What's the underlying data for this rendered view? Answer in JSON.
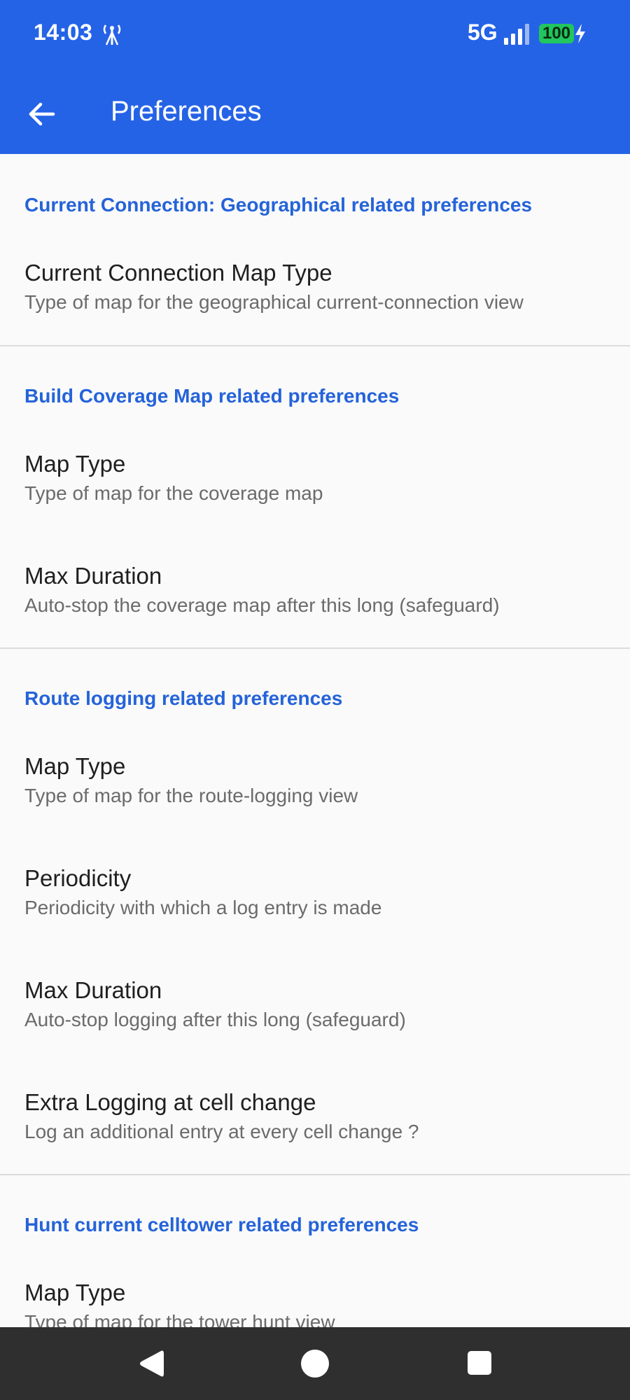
{
  "status_bar": {
    "time": "14:03",
    "network": "5G",
    "battery": "100",
    "icons": [
      "antenna-icon",
      "signal-icon",
      "battery-icon",
      "charging-bolt-icon"
    ]
  },
  "app_bar": {
    "title": "Preferences",
    "back_icon": "arrow-left-icon",
    "color": "#2563e6"
  },
  "sections": [
    {
      "header": "Current Connection: Geographical related preferences",
      "items": [
        {
          "title": "Current Connection Map Type",
          "summary": "Type of map for the geographical current-connection view"
        }
      ]
    },
    {
      "header": "Build Coverage Map related preferences",
      "items": [
        {
          "title": "Map Type",
          "summary": "Type of map for the coverage map"
        },
        {
          "title": "Max Duration",
          "summary": "Auto-stop the coverage map after this long (safeguard)"
        }
      ]
    },
    {
      "header": "Route logging related preferences",
      "items": [
        {
          "title": "Map Type",
          "summary": "Type of map for the route-logging view"
        },
        {
          "title": "Periodicity",
          "summary": "Periodicity with which a log entry is made"
        },
        {
          "title": "Max Duration",
          "summary": "Auto-stop logging after this long (safeguard)"
        },
        {
          "title": "Extra Logging at cell change",
          "summary": "Log an additional entry at every cell change ?"
        }
      ]
    },
    {
      "header": "Hunt current celltower related preferences",
      "items": [
        {
          "title": "Map Type",
          "summary": "Type of map for the tower hunt view"
        }
      ]
    }
  ],
  "nav_bar": {
    "icons": [
      "nav-back-icon",
      "nav-home-icon",
      "nav-recents-icon"
    ]
  },
  "colors": {
    "accent": "#2563d9",
    "background": "#fafafa",
    "title_text": "#1f1f1f",
    "summary_text": "#6b6b6b"
  }
}
